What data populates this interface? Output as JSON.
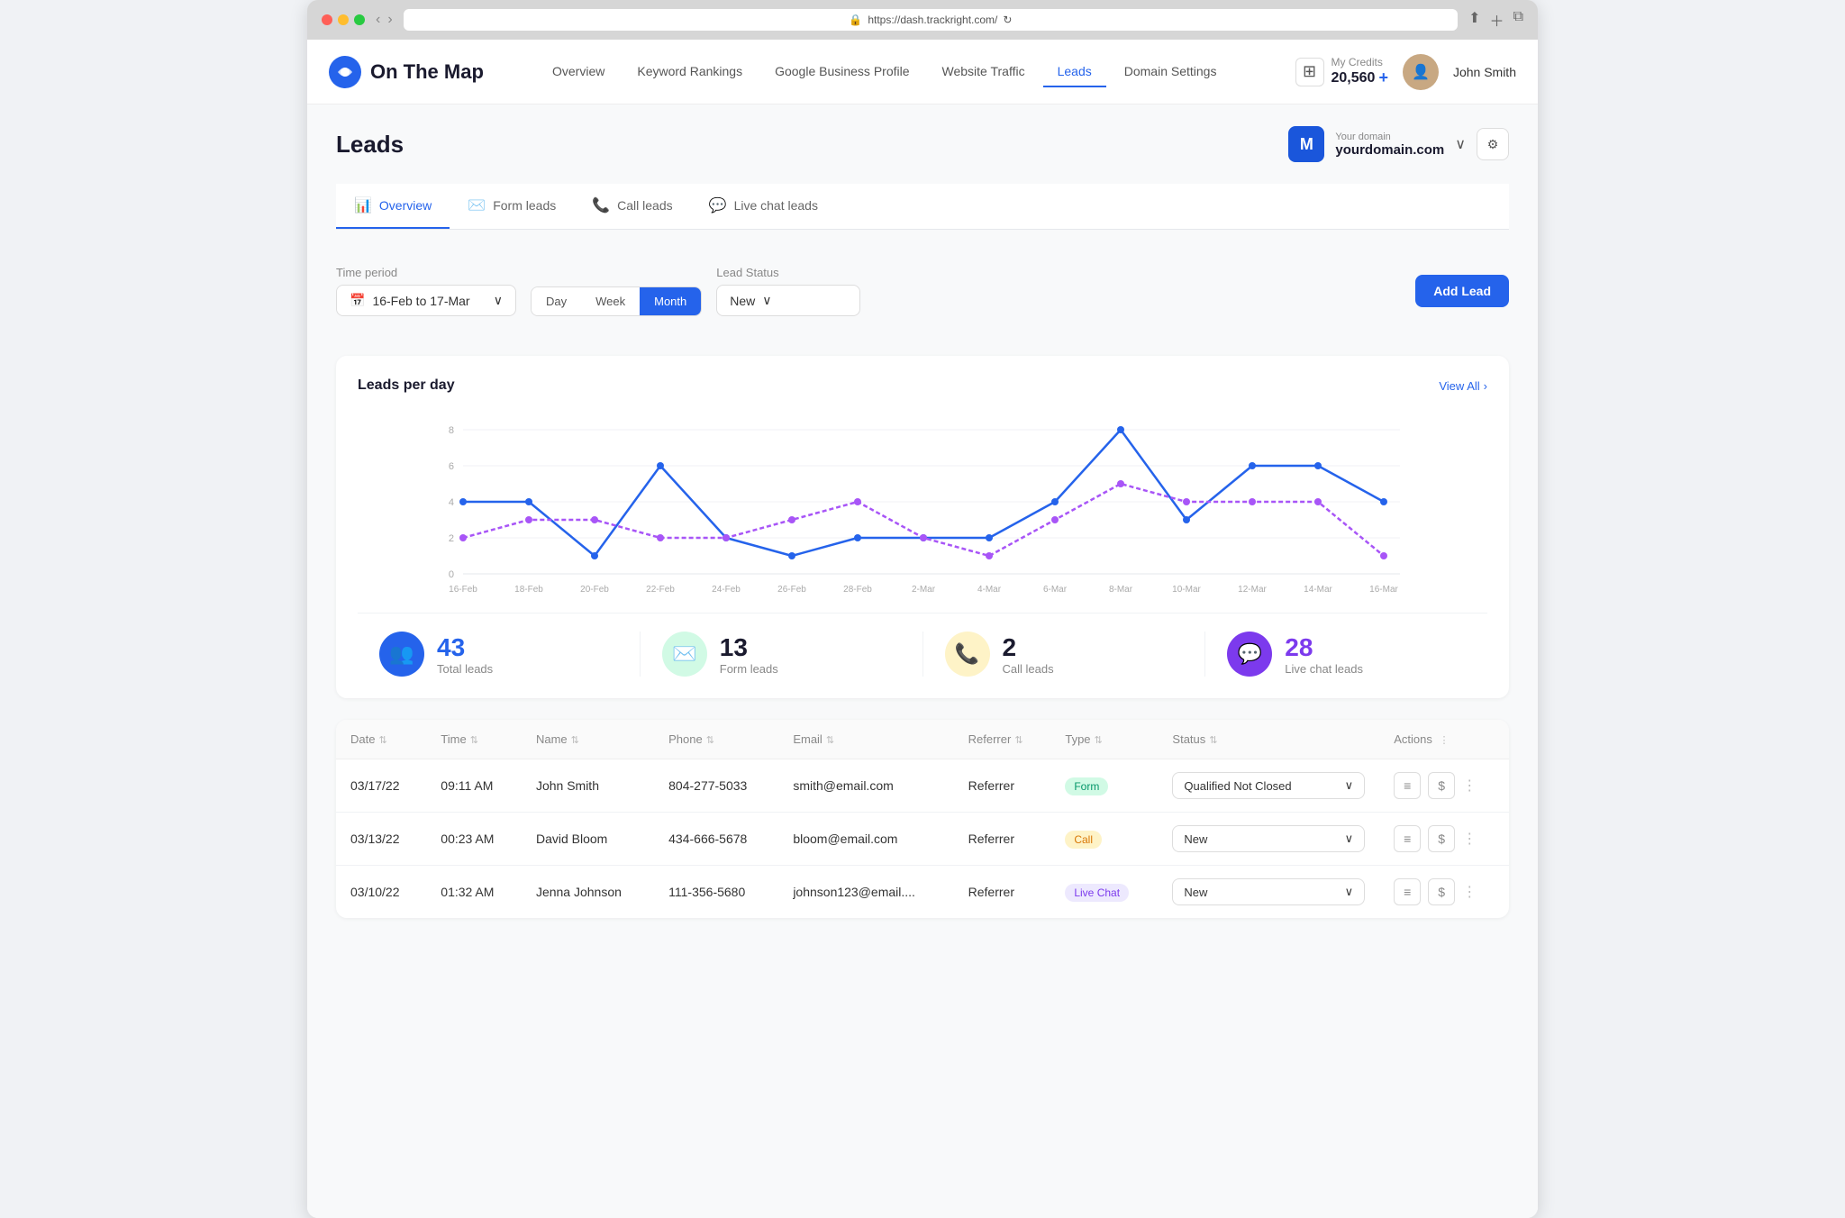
{
  "browser": {
    "url": "https://dash.trackright.com/"
  },
  "app": {
    "logo_text": "On The Map",
    "nav": {
      "links": [
        {
          "label": "Overview",
          "active": false
        },
        {
          "label": "Keyword Rankings",
          "active": false
        },
        {
          "label": "Google Business Profile",
          "active": false
        },
        {
          "label": "Website Traffic",
          "active": false
        },
        {
          "label": "Leads",
          "active": true
        },
        {
          "label": "Domain Settings",
          "active": false
        }
      ]
    },
    "credits": {
      "label": "My Credits",
      "amount": "20,560",
      "plus": "+"
    },
    "user": {
      "name": "John Smith"
    },
    "domain": {
      "label": "Your domain",
      "name": "yourdomain.com"
    }
  },
  "page": {
    "title": "Leads",
    "tabs": [
      {
        "label": "Overview",
        "icon": "📊",
        "active": true
      },
      {
        "label": "Form leads",
        "icon": "✉️",
        "active": false
      },
      {
        "label": "Call leads",
        "icon": "📞",
        "active": false
      },
      {
        "label": "Live chat leads",
        "icon": "💬",
        "active": false
      }
    ],
    "filters": {
      "time_period_label": "Time period",
      "date_range": "16-Feb to 17-Mar",
      "period_buttons": [
        "Day",
        "Week",
        "Month"
      ],
      "active_period": "Month",
      "lead_status_label": "Lead Status",
      "lead_status_value": "New",
      "add_lead_label": "Add Lead"
    },
    "chart": {
      "title": "Leads per day",
      "view_all": "View All",
      "x_labels": [
        "16-Feb",
        "18-Feb",
        "20-Feb",
        "22-Feb",
        "24-Feb",
        "26-Feb",
        "28-Feb",
        "2-Mar",
        "4-Mar",
        "6-Mar",
        "8-Mar",
        "10-Mar",
        "12-Mar",
        "14-Mar",
        "16-Mar"
      ],
      "y_labels": [
        "0",
        "2",
        "4",
        "6",
        "8"
      ]
    },
    "stats": [
      {
        "number": "43",
        "label": "Total leads",
        "icon": "👥",
        "color": "blue"
      },
      {
        "number": "13",
        "label": "Form leads",
        "icon": "✉️",
        "color": "green"
      },
      {
        "number": "2",
        "label": "Call leads",
        "icon": "📞",
        "color": "orange"
      },
      {
        "number": "28",
        "label": "Live chat leads",
        "icon": "💬",
        "color": "purple"
      }
    ],
    "table": {
      "columns": [
        "Date",
        "Time",
        "Name",
        "Phone",
        "Email",
        "Referrer",
        "Type",
        "Status",
        "Actions"
      ],
      "rows": [
        {
          "date": "03/17/22",
          "time": "09:11 AM",
          "name": "John Smith",
          "phone": "804-277-5033",
          "email": "smith@email.com",
          "referrer": "Referrer",
          "type": "Form",
          "type_class": "form",
          "status": "Qualified Not Closed"
        },
        {
          "date": "03/13/22",
          "time": "00:23 AM",
          "name": "David Bloom",
          "phone": "434-666-5678",
          "email": "bloom@email.com",
          "referrer": "Referrer",
          "type": "Call",
          "type_class": "call",
          "status": "New"
        },
        {
          "date": "03/10/22",
          "time": "01:32 AM",
          "name": "Jenna Johnson",
          "phone": "111-356-5680",
          "email": "johnson123@email....",
          "referrer": "Referrer",
          "type": "Live Chat",
          "type_class": "livechat",
          "status": "New"
        }
      ]
    }
  }
}
